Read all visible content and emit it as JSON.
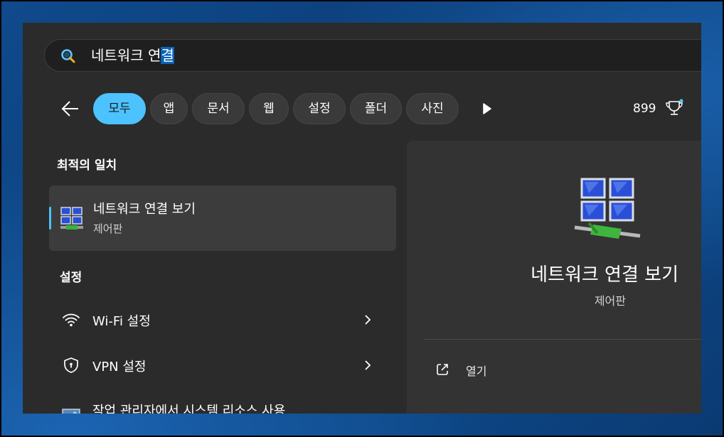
{
  "search": {
    "value_plain": "네트워크 연",
    "value_selected": "결"
  },
  "filters": {
    "chips": [
      "모두",
      "앱",
      "문서",
      "웹",
      "설정",
      "폴더",
      "사진"
    ],
    "points": "899"
  },
  "best_match": {
    "section_title": "최적의 일치",
    "title": "네트워크 연결 보기",
    "subtitle": "제어판"
  },
  "settings": {
    "section_title": "설정",
    "items": [
      {
        "label": "Wi-Fi 설정",
        "icon": "wifi-icon"
      },
      {
        "label": "VPN 설정",
        "icon": "shield-icon"
      },
      {
        "label": "작업 관리자에서 시스템 리소스 사용",
        "icon": "task-manager-icon"
      }
    ]
  },
  "preview": {
    "title": "네트워크 연결 보기",
    "subtitle": "제어판",
    "open_label": "열기"
  },
  "colors": {
    "accent": "#4cc2ff",
    "selection": "#0a63b8"
  }
}
